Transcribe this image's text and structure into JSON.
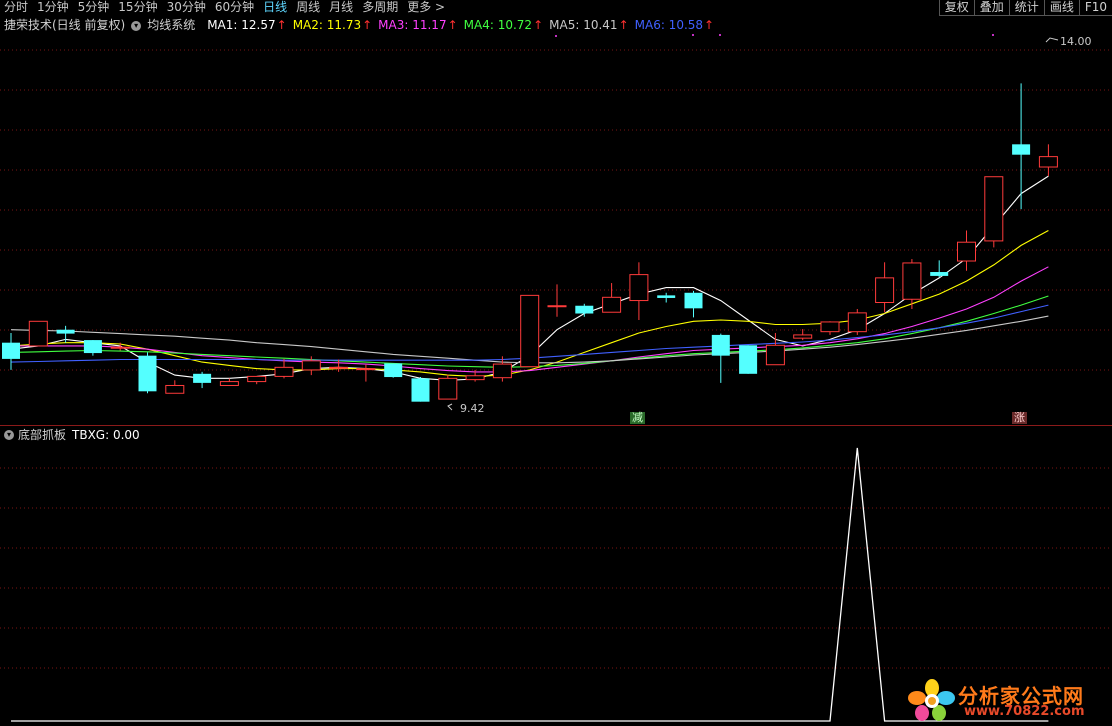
{
  "periods": {
    "tabs": [
      "分时",
      "1分钟",
      "5分钟",
      "15分钟",
      "30分钟",
      "60分钟",
      "日线",
      "周线",
      "月线",
      "多周期",
      "更多 >"
    ],
    "active": "日线"
  },
  "toolbar": [
    "复权",
    "叠加",
    "统计",
    "画线",
    "F10"
  ],
  "main_info": {
    "stock": "捷荣技术(日线 前复权)",
    "indicator": "均线系统",
    "ma": [
      {
        "label": "MA1: 12.57",
        "color": "#ffffff"
      },
      {
        "label": "MA2: 11.73",
        "color": "#ffff00"
      },
      {
        "label": "MA3: 11.17",
        "color": "#ff40ff"
      },
      {
        "label": "MA4: 10.72",
        "color": "#40ff40"
      },
      {
        "label": "MA5: 10.41",
        "color": "#c8c8c8"
      },
      {
        "label": "MA6: 10.58",
        "color": "#4060ff"
      }
    ],
    "arrow": "↑"
  },
  "price_labels": {
    "high": "14.00",
    "low": "9.42"
  },
  "signals": {
    "reduce": "减",
    "rise": "涨"
  },
  "sub_info": {
    "indicator": "底部抓板",
    "value": "TBXG: 0.00"
  },
  "watermark": {
    "title": "分析家公式网",
    "url": "www.70822.com"
  },
  "chart_data": {
    "type": "candlestick",
    "y_range": [
      8.9,
      14.7
    ],
    "candles": [
      {
        "o": 10.0,
        "c": 9.75,
        "h": 10.15,
        "l": 9.58
      },
      {
        "o": 9.95,
        "c": 10.33,
        "h": 10.33,
        "l": 9.95
      },
      {
        "o": 10.2,
        "c": 10.14,
        "h": 10.26,
        "l": 10.0
      },
      {
        "o": 10.04,
        "c": 9.84,
        "h": 10.04,
        "l": 9.8
      },
      {
        "o": 9.93,
        "c": 9.93,
        "h": 10.0,
        "l": 9.88
      },
      {
        "o": 9.8,
        "c": 9.25,
        "h": 9.85,
        "l": 9.22
      },
      {
        "o": 9.22,
        "c": 9.34,
        "h": 9.42,
        "l": 9.22
      },
      {
        "o": 9.52,
        "c": 9.38,
        "h": 9.55,
        "l": 9.3
      },
      {
        "o": 9.34,
        "c": 9.4,
        "h": 9.45,
        "l": 9.34
      },
      {
        "o": 9.4,
        "c": 9.48,
        "h": 9.48,
        "l": 9.36
      },
      {
        "o": 9.48,
        "c": 9.62,
        "h": 9.75,
        "l": 9.45
      },
      {
        "o": 9.58,
        "c": 9.72,
        "h": 9.79,
        "l": 9.5
      },
      {
        "o": 9.62,
        "c": 9.62,
        "h": 9.74,
        "l": 9.55
      },
      {
        "o": 9.6,
        "c": 9.6,
        "h": 9.66,
        "l": 9.4
      },
      {
        "o": 9.68,
        "c": 9.47,
        "h": 9.68,
        "l": 9.46
      },
      {
        "o": 9.45,
        "c": 9.09,
        "h": 9.47,
        "l": 9.09
      },
      {
        "o": 9.13,
        "c": 9.45,
        "h": 9.51,
        "l": 9.13
      },
      {
        "o": 9.43,
        "c": 9.49,
        "h": 9.58,
        "l": 9.4
      },
      {
        "o": 9.46,
        "c": 9.67,
        "h": 9.79,
        "l": 9.4
      },
      {
        "o": 9.63,
        "c": 10.73,
        "h": 10.73,
        "l": 9.63
      },
      {
        "o": 10.57,
        "c": 10.57,
        "h": 10.9,
        "l": 10.4
      },
      {
        "o": 10.57,
        "c": 10.45,
        "h": 10.6,
        "l": 10.4
      },
      {
        "o": 10.47,
        "c": 10.7,
        "h": 10.92,
        "l": 10.47
      },
      {
        "o": 10.65,
        "c": 11.05,
        "h": 11.24,
        "l": 10.35
      },
      {
        "o": 10.73,
        "c": 10.69,
        "h": 10.77,
        "l": 10.62
      },
      {
        "o": 10.77,
        "c": 10.53,
        "h": 10.8,
        "l": 10.39
      },
      {
        "o": 10.12,
        "c": 9.8,
        "h": 10.14,
        "l": 9.38
      },
      {
        "o": 9.96,
        "c": 9.52,
        "h": 9.96,
        "l": 9.52
      },
      {
        "o": 9.66,
        "c": 9.96,
        "h": 10.15,
        "l": 9.66
      },
      {
        "o": 10.07,
        "c": 10.12,
        "h": 10.21,
        "l": 10.04
      },
      {
        "o": 10.17,
        "c": 10.32,
        "h": 10.33,
        "l": 10.12
      },
      {
        "o": 10.17,
        "c": 10.46,
        "h": 10.52,
        "l": 10.12
      },
      {
        "o": 10.62,
        "c": 11.0,
        "h": 11.24,
        "l": 10.47
      },
      {
        "o": 10.67,
        "c": 11.23,
        "h": 11.29,
        "l": 10.52
      },
      {
        "o": 11.09,
        "c": 11.03,
        "h": 11.27,
        "l": 11.01
      },
      {
        "o": 11.26,
        "c": 11.55,
        "h": 11.73,
        "l": 11.11
      },
      {
        "o": 11.57,
        "c": 12.56,
        "h": 12.56,
        "l": 11.47
      },
      {
        "o": 13.06,
        "c": 12.9,
        "h": 14.0,
        "l": 12.06
      },
      {
        "o": 12.71,
        "c": 12.87,
        "h": 13.06,
        "l": 12.57
      }
    ],
    "ma_lines": [
      {
        "name": "MA1",
        "color": "#ffffff",
        "values": [
          9.9,
          9.95,
          10.05,
          10.0,
          9.95,
          9.7,
          9.5,
          9.45,
          9.45,
          9.48,
          9.52,
          9.6,
          9.62,
          9.6,
          9.55,
          9.45,
          9.42,
          9.44,
          9.55,
          9.8,
          10.2,
          10.45,
          10.6,
          10.75,
          10.85,
          10.85,
          10.65,
          10.35,
          10.05,
          9.95,
          10.05,
          10.2,
          10.45,
          10.75,
          11.0,
          11.3,
          11.8,
          12.3,
          12.57
        ]
      },
      {
        "name": "MA2",
        "color": "#ffff00",
        "values": [
          9.95,
          9.98,
          10.0,
          10.0,
          9.98,
          9.9,
          9.8,
          9.7,
          9.65,
          9.6,
          9.58,
          9.58,
          9.6,
          9.6,
          9.58,
          9.55,
          9.5,
          9.48,
          9.5,
          9.58,
          9.7,
          9.85,
          10.0,
          10.15,
          10.25,
          10.33,
          10.35,
          10.33,
          10.28,
          10.28,
          10.3,
          10.35,
          10.45,
          10.6,
          10.75,
          10.95,
          11.2,
          11.5,
          11.73
        ]
      },
      {
        "name": "MA3",
        "color": "#ff40ff",
        "values": [
          9.95,
          9.95,
          9.95,
          9.95,
          9.93,
          9.9,
          9.85,
          9.8,
          9.77,
          9.74,
          9.72,
          9.7,
          9.69,
          9.67,
          9.64,
          9.6,
          9.57,
          9.55,
          9.55,
          9.57,
          9.62,
          9.67,
          9.72,
          9.78,
          9.83,
          9.88,
          9.9,
          9.92,
          9.94,
          9.96,
          10.0,
          10.06,
          10.14,
          10.25,
          10.38,
          10.52,
          10.7,
          10.95,
          11.17
        ]
      },
      {
        "name": "MA4",
        "color": "#40ff40",
        "values": [
          9.85,
          9.86,
          9.87,
          9.88,
          9.87,
          9.86,
          9.84,
          9.82,
          9.8,
          9.78,
          9.76,
          9.74,
          9.72,
          9.7,
          9.68,
          9.66,
          9.64,
          9.63,
          9.62,
          9.63,
          9.65,
          9.68,
          9.72,
          9.76,
          9.8,
          9.83,
          9.85,
          9.87,
          9.89,
          9.92,
          9.96,
          10.0,
          10.06,
          10.14,
          10.23,
          10.33,
          10.45,
          10.58,
          10.72
        ]
      },
      {
        "name": "MA5",
        "color": "#c8c8c8",
        "values": [
          10.2,
          10.19,
          10.18,
          10.16,
          10.14,
          10.12,
          10.1,
          10.07,
          10.04,
          10.0,
          9.97,
          9.94,
          9.9,
          9.86,
          9.82,
          9.79,
          9.76,
          9.73,
          9.7,
          9.69,
          9.69,
          9.7,
          9.72,
          9.75,
          9.78,
          9.81,
          9.83,
          9.85,
          9.87,
          9.9,
          9.93,
          9.97,
          10.02,
          10.07,
          10.13,
          10.19,
          10.26,
          10.33,
          10.41
        ]
      },
      {
        "name": "MA6",
        "color": "#4060ff",
        "values": [
          9.7,
          9.71,
          9.72,
          9.73,
          9.74,
          9.74,
          9.74,
          9.74,
          9.74,
          9.74,
          9.73,
          9.73,
          9.73,
          9.73,
          9.73,
          9.73,
          9.73,
          9.73,
          9.74,
          9.76,
          9.79,
          9.82,
          9.85,
          9.88,
          9.91,
          9.93,
          9.95,
          9.97,
          9.99,
          10.01,
          10.04,
          10.08,
          10.12,
          10.17,
          10.23,
          10.3,
          10.38,
          10.48,
          10.58
        ]
      }
    ],
    "signal_markers": [
      {
        "text": "减",
        "bar": 23
      },
      {
        "text": "涨",
        "bar": 37
      }
    ],
    "sub_indicator": {
      "name": "TBXG",
      "y_range": [
        0,
        1
      ],
      "values": [
        0,
        0,
        0,
        0,
        0,
        0,
        0,
        0,
        0,
        0,
        0,
        0,
        0,
        0,
        0,
        0,
        0,
        0,
        0,
        0,
        0,
        0,
        0,
        0,
        0,
        0,
        0,
        0,
        0,
        0,
        0,
        1,
        0,
        0,
        0,
        0,
        0,
        0,
        0
      ]
    }
  }
}
